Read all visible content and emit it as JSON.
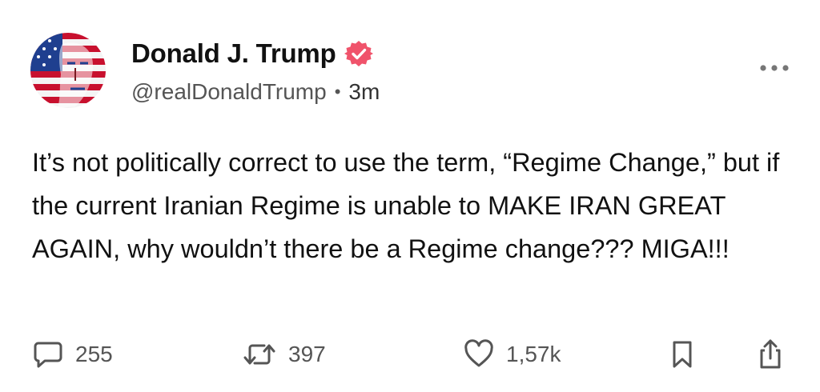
{
  "author": {
    "display_name": "Donald J. Trump",
    "handle": "@realDonaldTrump",
    "separator": "•",
    "timestamp": "3m",
    "verified_color": "#f0536b"
  },
  "post": {
    "text": "It’s not politically correct to use the term, “Regime Change,” but if the current Iranian Regime is unable to MAKE IRAN GREAT AGAIN, why wouldn’t there be a Regime change??? MIGA!!!"
  },
  "actions": {
    "replies": "255",
    "reposts": "397",
    "likes": "1,57k"
  },
  "icons": {
    "more": "more-dots-icon",
    "reply": "comment-bubble-icon",
    "repost": "repost-arrows-icon",
    "like": "heart-icon",
    "bookmark": "bookmark-icon",
    "share": "share-icon"
  },
  "colors": {
    "text": "#111111",
    "muted": "#555555",
    "icon": "#555555",
    "badge": "#f0536b"
  }
}
